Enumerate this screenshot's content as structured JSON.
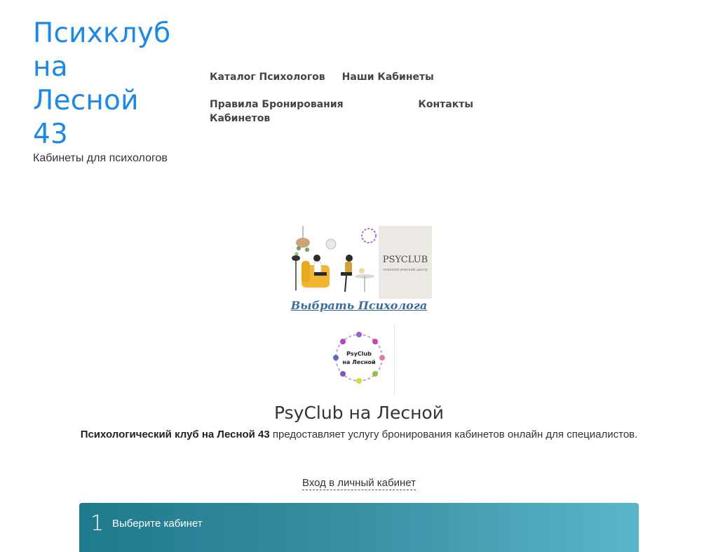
{
  "site": {
    "title": "Психклуб на Лесной 43",
    "tagline": "Кабинеты для психологов"
  },
  "nav": {
    "items": [
      {
        "label": "Каталог Психологов"
      },
      {
        "label": "Наши Кабинеты"
      },
      {
        "label": "Правила Бронирования Кабинетов"
      },
      {
        "label": "Контакты"
      }
    ]
  },
  "hero": {
    "psyclub_text": "PSYCLUB",
    "psyclub_sub": "психологический центр",
    "choose_link": "Выбрать Психолога"
  },
  "logo": {
    "line1": "PsyClub",
    "line2": "на Лесной"
  },
  "club": {
    "title": "PsyClub на Лесной",
    "desc_bold": "Психологический клуб на Лесной 43",
    "desc_rest": " предоставляет услугу бронирования кабинетов онлайн для специалистов."
  },
  "login": {
    "label": "Вход в личный кабинет"
  },
  "step": {
    "number": "1",
    "label": "Выберите кабинет"
  },
  "colors": {
    "accent": "#1e88e5",
    "link": "#3b6c9c",
    "step_start": "#1e7a8c",
    "step_end": "#5ab6c9"
  }
}
